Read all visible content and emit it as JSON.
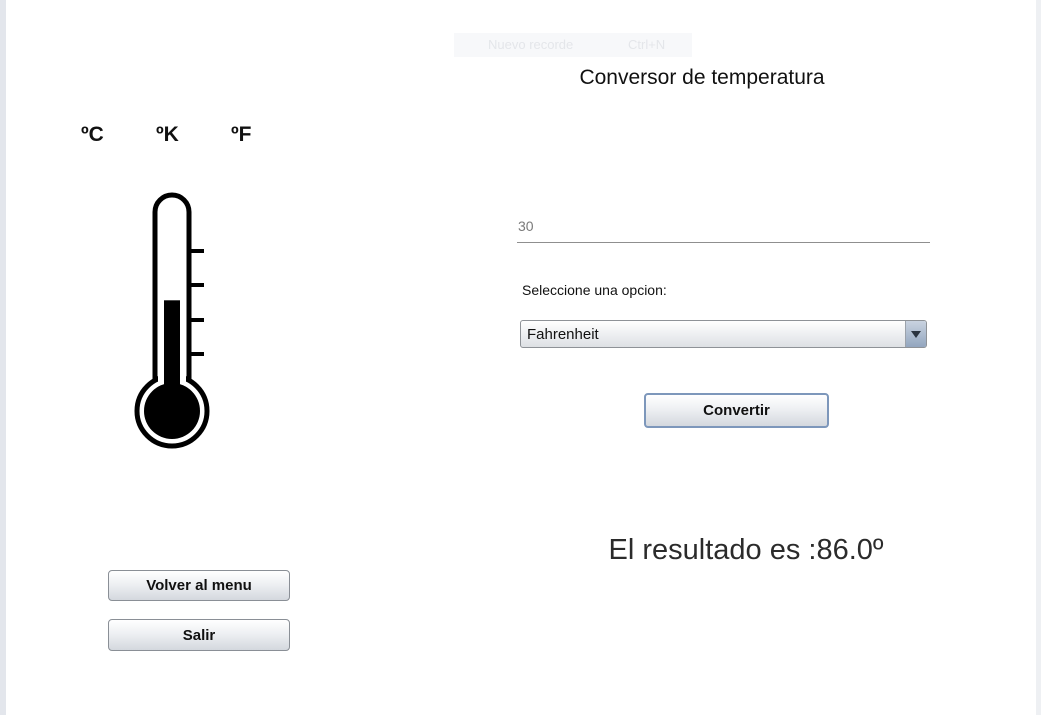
{
  "window": {
    "title": "Conversor de temperatura"
  },
  "ghost_menu": {
    "label": "Nuevo recorde",
    "shortcut": "Ctrl+N"
  },
  "units": {
    "celsius": "ºC",
    "kelvin": "ºK",
    "fahrenheit": "ºF"
  },
  "thermometer": {
    "icon": "thermometer-icon",
    "fill_level": 0.55
  },
  "form": {
    "input_value": "30",
    "option_label": "Seleccione una opcion:",
    "selected_option": "Fahrenheit",
    "convert_label": "Convertir"
  },
  "result": {
    "text": "El resultado es :86.0º"
  },
  "nav": {
    "menu_label": "Volver al menu",
    "exit_label": "Salir"
  },
  "colors": {
    "button_border_accent": "#7d97bb",
    "select_arrow": "#93a6bf"
  }
}
